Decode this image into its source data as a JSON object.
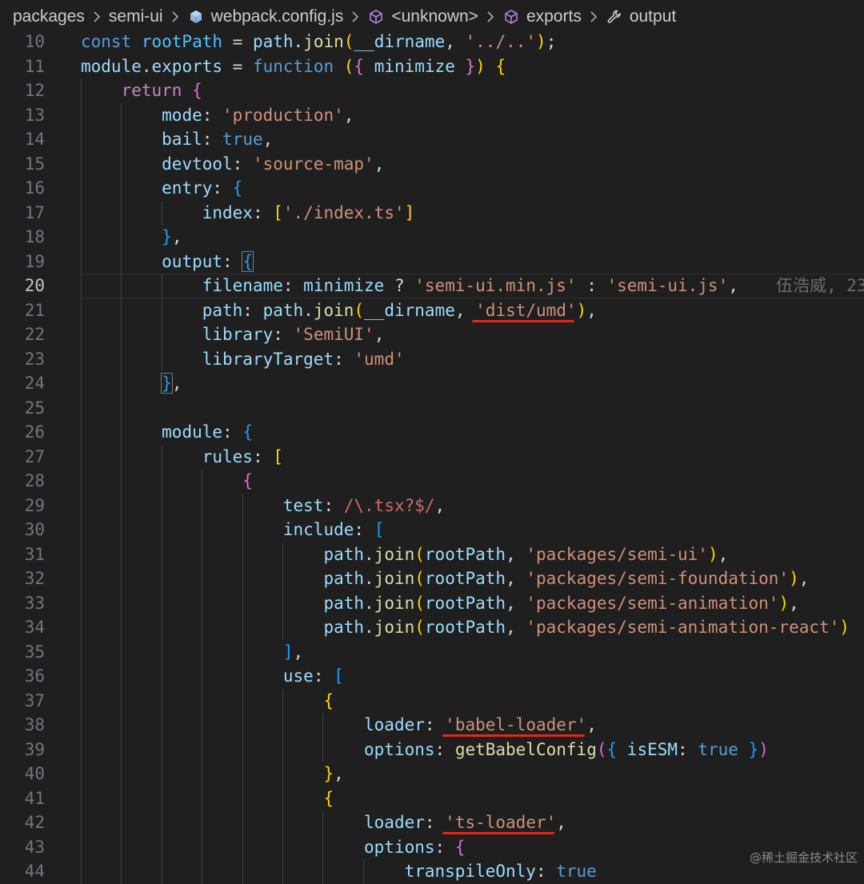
{
  "breadcrumb": {
    "items": [
      "packages",
      "semi-ui",
      "webpack.config.js",
      "<unknown>",
      "exports",
      "output"
    ],
    "icons": [
      "",
      "",
      "js-file-icon",
      "cube-icon",
      "cube-icon",
      "wrench-icon"
    ]
  },
  "editor": {
    "current_line": 20,
    "blame": "伍浩威, 23",
    "underlined_strings": [
      "'dist/umd'",
      "'babel-loader'",
      "'ts-loader'"
    ],
    "lines": [
      {
        "n": "10",
        "indent": 0,
        "t": [
          [
            "kw",
            "const "
          ],
          [
            "cst",
            "rootPath"
          ],
          [
            "op",
            " = "
          ],
          [
            "var",
            "path"
          ],
          [
            "op",
            "."
          ],
          [
            "fn",
            "join"
          ],
          [
            "b1",
            "("
          ],
          [
            "var",
            "__dirname"
          ],
          [
            "op",
            ", "
          ],
          [
            "str",
            "'../..'"
          ],
          [
            "b1",
            ")"
          ],
          [
            "op",
            ";"
          ]
        ]
      },
      {
        "n": "11",
        "indent": 0,
        "t": [
          [
            "var",
            "module"
          ],
          [
            "op",
            "."
          ],
          [
            "var",
            "exports"
          ],
          [
            "op",
            " = "
          ],
          [
            "kw",
            "function "
          ],
          [
            "b1",
            "("
          ],
          [
            "b2",
            "{ "
          ],
          [
            "var",
            "minimize"
          ],
          [
            "b2",
            " }"
          ],
          [
            "b1",
            ")"
          ],
          [
            "op",
            " "
          ],
          [
            "b1",
            "{"
          ]
        ]
      },
      {
        "n": "12",
        "indent": 1,
        "t": [
          [
            "ctl",
            "return "
          ],
          [
            "b2",
            "{"
          ]
        ]
      },
      {
        "n": "13",
        "indent": 2,
        "t": [
          [
            "var",
            "mode"
          ],
          [
            "op",
            ": "
          ],
          [
            "str",
            "'production'"
          ],
          [
            "op",
            ","
          ]
        ]
      },
      {
        "n": "14",
        "indent": 2,
        "t": [
          [
            "var",
            "bail"
          ],
          [
            "op",
            ": "
          ],
          [
            "kw",
            "true"
          ],
          [
            "op",
            ","
          ]
        ]
      },
      {
        "n": "15",
        "indent": 2,
        "t": [
          [
            "var",
            "devtool"
          ],
          [
            "op",
            ": "
          ],
          [
            "str",
            "'source-map'"
          ],
          [
            "op",
            ","
          ]
        ]
      },
      {
        "n": "16",
        "indent": 2,
        "t": [
          [
            "var",
            "entry"
          ],
          [
            "op",
            ": "
          ],
          [
            "b3",
            "{"
          ]
        ]
      },
      {
        "n": "17",
        "indent": 3,
        "t": [
          [
            "var",
            "index"
          ],
          [
            "op",
            ": "
          ],
          [
            "b1",
            "["
          ],
          [
            "str",
            "'./index.ts'"
          ],
          [
            "b1",
            "]"
          ]
        ]
      },
      {
        "n": "18",
        "indent": 2,
        "t": [
          [
            "b3",
            "}"
          ],
          [
            "op",
            ","
          ]
        ]
      },
      {
        "n": "19",
        "indent": 2,
        "t": [
          [
            "var",
            "output"
          ],
          [
            "op",
            ": "
          ],
          [
            "b3 hl",
            "{"
          ]
        ]
      },
      {
        "n": "20",
        "indent": 3,
        "t": [
          [
            "var",
            "filename"
          ],
          [
            "op",
            ": "
          ],
          [
            "var",
            "minimize"
          ],
          [
            "op",
            " ? "
          ],
          [
            "str",
            "'semi-ui.min.js'"
          ],
          [
            "op",
            " : "
          ],
          [
            "str",
            "'semi-ui.js'"
          ],
          [
            "op",
            ","
          ]
        ]
      },
      {
        "n": "21",
        "indent": 3,
        "t": [
          [
            "var",
            "path"
          ],
          [
            "op",
            ": "
          ],
          [
            "var",
            "path"
          ],
          [
            "op",
            "."
          ],
          [
            "fn",
            "join"
          ],
          [
            "b1",
            "("
          ],
          [
            "var",
            "__dirname"
          ],
          [
            "op",
            ", "
          ],
          [
            "str",
            "'dist/umd'"
          ],
          [
            "b1",
            ")"
          ],
          [
            "op",
            ","
          ]
        ]
      },
      {
        "n": "22",
        "indent": 3,
        "t": [
          [
            "var",
            "library"
          ],
          [
            "op",
            ": "
          ],
          [
            "str",
            "'SemiUI'"
          ],
          [
            "op",
            ","
          ]
        ]
      },
      {
        "n": "23",
        "indent": 3,
        "t": [
          [
            "var",
            "libraryTarget"
          ],
          [
            "op",
            ": "
          ],
          [
            "str",
            "'umd'"
          ]
        ]
      },
      {
        "n": "24",
        "indent": 2,
        "t": [
          [
            "b3 hl",
            "}"
          ],
          [
            "op",
            ","
          ]
        ]
      },
      {
        "n": "25",
        "indent": 0,
        "t": []
      },
      {
        "n": "26",
        "indent": 2,
        "t": [
          [
            "var",
            "module"
          ],
          [
            "op",
            ": "
          ],
          [
            "b3",
            "{"
          ]
        ]
      },
      {
        "n": "27",
        "indent": 3,
        "t": [
          [
            "var",
            "rules"
          ],
          [
            "op",
            ": "
          ],
          [
            "b1",
            "["
          ]
        ]
      },
      {
        "n": "28",
        "indent": 4,
        "t": [
          [
            "b2",
            "{"
          ]
        ]
      },
      {
        "n": "29",
        "indent": 5,
        "t": [
          [
            "var",
            "test"
          ],
          [
            "op",
            ": "
          ],
          [
            "rx",
            "/\\.tsx?$/"
          ],
          [
            "op",
            ","
          ]
        ]
      },
      {
        "n": "30",
        "indent": 5,
        "t": [
          [
            "var",
            "include"
          ],
          [
            "op",
            ": "
          ],
          [
            "b3",
            "["
          ]
        ]
      },
      {
        "n": "31",
        "indent": 6,
        "t": [
          [
            "var",
            "path"
          ],
          [
            "op",
            "."
          ],
          [
            "fn",
            "join"
          ],
          [
            "b1",
            "("
          ],
          [
            "var",
            "rootPath"
          ],
          [
            "op",
            ", "
          ],
          [
            "str",
            "'packages/semi-ui'"
          ],
          [
            "b1",
            ")"
          ],
          [
            "op",
            ","
          ]
        ]
      },
      {
        "n": "32",
        "indent": 6,
        "t": [
          [
            "var",
            "path"
          ],
          [
            "op",
            "."
          ],
          [
            "fn",
            "join"
          ],
          [
            "b1",
            "("
          ],
          [
            "var",
            "rootPath"
          ],
          [
            "op",
            ", "
          ],
          [
            "str",
            "'packages/semi-foundation'"
          ],
          [
            "b1",
            ")"
          ],
          [
            "op",
            ","
          ]
        ]
      },
      {
        "n": "33",
        "indent": 6,
        "t": [
          [
            "var",
            "path"
          ],
          [
            "op",
            "."
          ],
          [
            "fn",
            "join"
          ],
          [
            "b1",
            "("
          ],
          [
            "var",
            "rootPath"
          ],
          [
            "op",
            ", "
          ],
          [
            "str",
            "'packages/semi-animation'"
          ],
          [
            "b1",
            ")"
          ],
          [
            "op",
            ","
          ]
        ]
      },
      {
        "n": "34",
        "indent": 6,
        "t": [
          [
            "var",
            "path"
          ],
          [
            "op",
            "."
          ],
          [
            "fn",
            "join"
          ],
          [
            "b1",
            "("
          ],
          [
            "var",
            "rootPath"
          ],
          [
            "op",
            ", "
          ],
          [
            "str",
            "'packages/semi-animation-react'"
          ],
          [
            "b1",
            ")"
          ]
        ]
      },
      {
        "n": "35",
        "indent": 5,
        "t": [
          [
            "b3",
            "]"
          ],
          [
            "op",
            ","
          ]
        ]
      },
      {
        "n": "36",
        "indent": 5,
        "t": [
          [
            "var",
            "use"
          ],
          [
            "op",
            ": "
          ],
          [
            "b3",
            "["
          ]
        ]
      },
      {
        "n": "37",
        "indent": 6,
        "t": [
          [
            "b1",
            "{"
          ]
        ]
      },
      {
        "n": "38",
        "indent": 7,
        "t": [
          [
            "var",
            "loader"
          ],
          [
            "op",
            ": "
          ],
          [
            "str",
            "'babel-loader'"
          ],
          [
            "op",
            ","
          ]
        ]
      },
      {
        "n": "39",
        "indent": 7,
        "t": [
          [
            "var",
            "options"
          ],
          [
            "op",
            ": "
          ],
          [
            "fn",
            "getBabelConfig"
          ],
          [
            "b2",
            "("
          ],
          [
            "b3",
            "{ "
          ],
          [
            "var",
            "isESM"
          ],
          [
            "op",
            ": "
          ],
          [
            "kw",
            "true"
          ],
          [
            "b3",
            " }"
          ],
          [
            "b2",
            ")"
          ]
        ]
      },
      {
        "n": "40",
        "indent": 6,
        "t": [
          [
            "b1",
            "}"
          ],
          [
            "op",
            ","
          ]
        ]
      },
      {
        "n": "41",
        "indent": 6,
        "t": [
          [
            "b1",
            "{"
          ]
        ]
      },
      {
        "n": "42",
        "indent": 7,
        "t": [
          [
            "var",
            "loader"
          ],
          [
            "op",
            ": "
          ],
          [
            "str",
            "'ts-loader'"
          ],
          [
            "op",
            ","
          ]
        ]
      },
      {
        "n": "43",
        "indent": 7,
        "t": [
          [
            "var",
            "options"
          ],
          [
            "op",
            ": "
          ],
          [
            "b2",
            "{"
          ]
        ]
      },
      {
        "n": "44",
        "indent": 8,
        "t": [
          [
            "var",
            "transpileOnly"
          ],
          [
            "op",
            ": "
          ],
          [
            "kw",
            "true"
          ]
        ]
      }
    ]
  },
  "watermark": "@稀土掘金技术社区"
}
